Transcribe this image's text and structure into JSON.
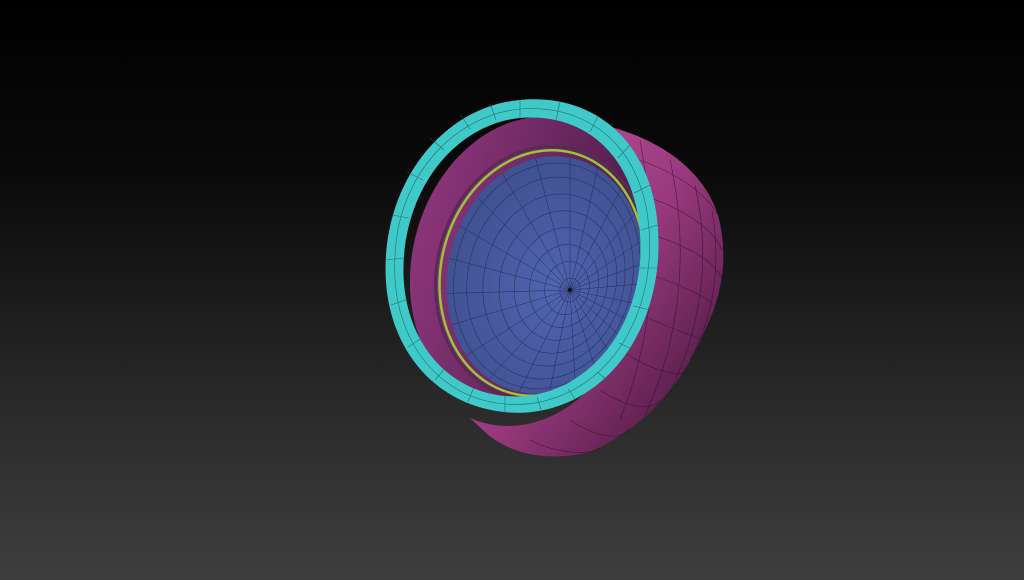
{
  "viewport": {
    "background_top": "#000000",
    "background_bottom": "#3e3e3e"
  },
  "model": {
    "object": "cap-mesh",
    "display": "polyframe",
    "polygroup_colors": {
      "rim": "#3fc9c9",
      "outer_wall": "#b64a93",
      "inner_wall": "#7a2f6a",
      "bottom_disc": "#4a5fa8",
      "thread_ring": "#9ac43a",
      "wire": "#1a1030"
    }
  }
}
